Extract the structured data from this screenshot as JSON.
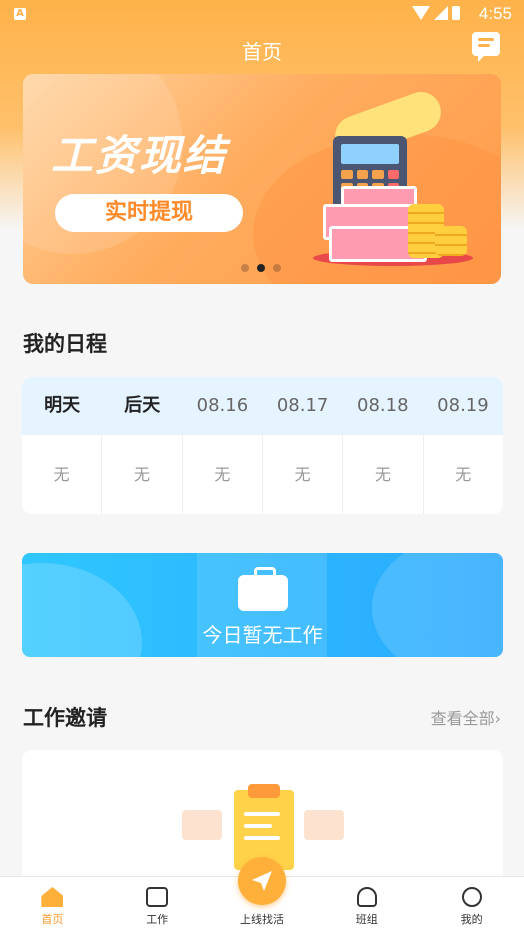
{
  "status_bar": {
    "time": "4:55",
    "app_badge": "A"
  },
  "header": {
    "title": "首页"
  },
  "banner": {
    "headline": "工资现结",
    "pill_label": "实时提现",
    "page_indicator": {
      "pages": 3,
      "active": 2
    }
  },
  "schedule": {
    "title": "我的日程",
    "columns": [
      {
        "label": "明天",
        "status": "无"
      },
      {
        "label": "后天",
        "status": "无"
      },
      {
        "label": "08.16",
        "status": "无"
      },
      {
        "label": "08.17",
        "status": "无"
      },
      {
        "label": "08.18",
        "status": "无"
      },
      {
        "label": "08.19",
        "status": "无"
      }
    ]
  },
  "no_work_banner": {
    "text": "今日暂无工作"
  },
  "invitations": {
    "title": "工作邀请",
    "more_label": "查看全部",
    "more_chevron": "›"
  },
  "tab_bar": {
    "tabs": [
      {
        "label": "首页",
        "icon": "home-icon",
        "active": true
      },
      {
        "label": "工作",
        "icon": "briefcase-icon"
      },
      {
        "label": "上线找活",
        "icon": "paper-plane-icon"
      },
      {
        "label": "班组",
        "icon": "team-icon"
      },
      {
        "label": "我的",
        "icon": "user-icon"
      }
    ]
  },
  "colors": {
    "accent": "#ffb03a",
    "blue_banner": "#2aa8ff"
  }
}
